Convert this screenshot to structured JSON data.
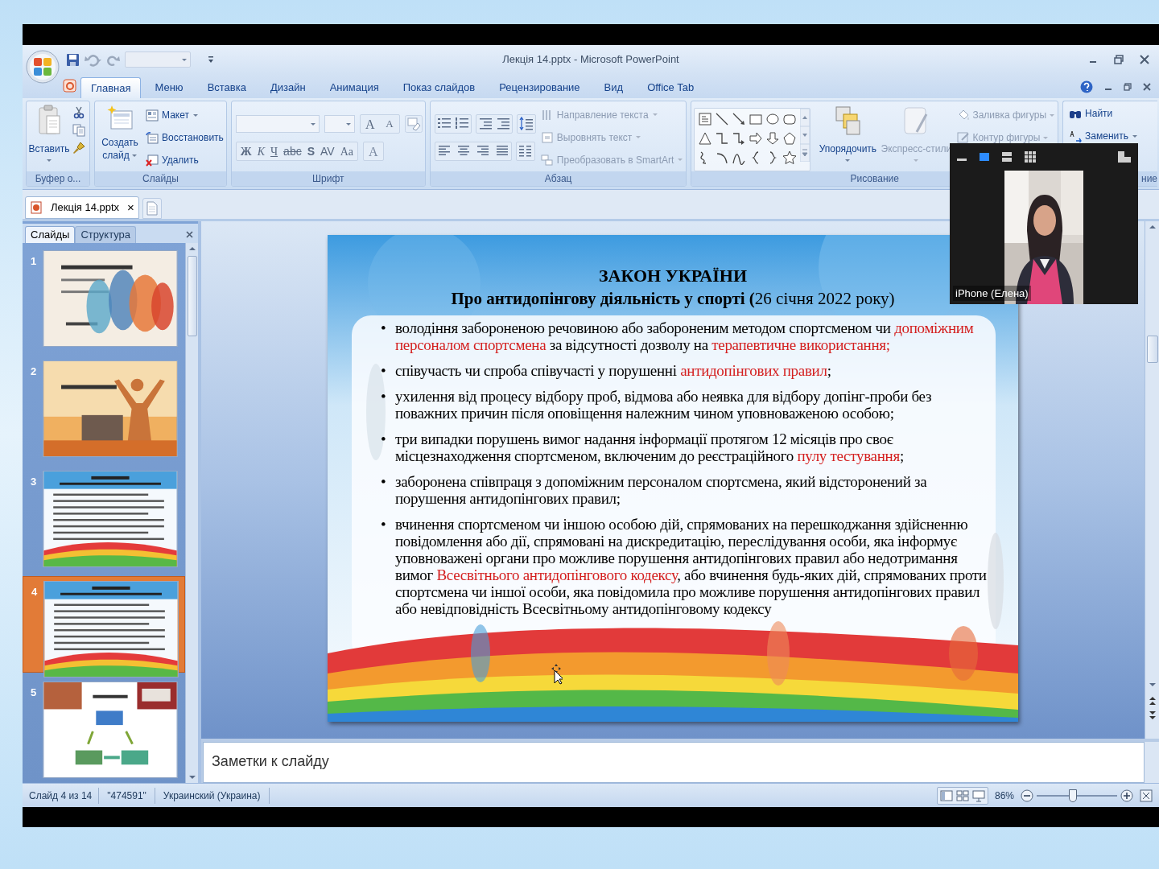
{
  "window": {
    "title": "Лекція 14.pptx - Microsoft PowerPoint"
  },
  "ribbon_tabs": [
    {
      "label": "Главная",
      "selected": true
    },
    {
      "label": "Меню",
      "selected": false
    },
    {
      "label": "Вставка",
      "selected": false
    },
    {
      "label": "Дизайн",
      "selected": false
    },
    {
      "label": "Анимация",
      "selected": false
    },
    {
      "label": "Показ слайдов",
      "selected": false
    },
    {
      "label": "Рецензирование",
      "selected": false
    },
    {
      "label": "Вид",
      "selected": false
    },
    {
      "label": "Office Tab",
      "selected": false
    }
  ],
  "ribbon": {
    "clipboard": {
      "label": "Буфер о...",
      "paste": "Вставить"
    },
    "slides": {
      "label": "Слайды",
      "new_slide": [
        "Создать",
        "слайд"
      ],
      "commands": [
        "Макет",
        "Восстановить",
        "Удалить"
      ]
    },
    "font": {
      "label": "Шрифт",
      "size_buttons": [
        "A",
        "A"
      ],
      "format_buttons": [
        "Ж",
        "К",
        "Ч",
        "abc",
        "S",
        "AV",
        "Aa"
      ],
      "color_button": "A"
    },
    "paragraph": {
      "label": "Абзац",
      "text_commands": [
        {
          "label": "Направление текста",
          "disabled": true
        },
        {
          "label": "Выровнять текст",
          "disabled": true
        },
        {
          "label": "Преобразовать в SmartArt",
          "disabled": true
        }
      ]
    },
    "drawing": {
      "label": "Рисование",
      "arrange": {
        "label": "Упорядочить",
        "disabled": false
      },
      "quick_styles": {
        "label": "Экспресс-стили",
        "disabled": true
      },
      "shape_commands": [
        {
          "label": "Заливка фигуры",
          "disabled": true
        },
        {
          "label": "Контур фигуры",
          "disabled": true
        }
      ]
    },
    "editing": {
      "label": "ние",
      "commands": [
        "Найти",
        "Заменить"
      ]
    }
  },
  "document_tab": {
    "label": "Лекція 14.pptx",
    "close": "×"
  },
  "panel_tabs": [
    {
      "label": "Слайды",
      "selected": true
    },
    {
      "label": "Структура",
      "selected": false
    }
  ],
  "slides": [
    {
      "number": "1",
      "selected": false
    },
    {
      "number": "2",
      "selected": false
    },
    {
      "number": "3",
      "selected": false
    },
    {
      "number": "4",
      "selected": true
    },
    {
      "number": "5",
      "selected": false
    }
  ],
  "slide": {
    "title": "ЗАКОН УКРАЇНИ",
    "subtitle": "**Про антидопінгову діяльність у спорті (**26 січня 2022 року)",
    "bullet": "•",
    "bullets": [
      {
        "segments": [
          {
            "text": "володіння забороненою речовиною або забороненим методом спортсменом чи ",
            "red": false
          },
          {
            "text": "допоміжним персоналом спортсмена",
            "red": true
          },
          {
            "text": " за відсутності дозволу на ",
            "red": false
          },
          {
            "text": "терапевтичне використання;",
            "red": true
          }
        ]
      },
      {
        "segments": [
          {
            "text": "співучасть чи спроба співучасті у порушенні ",
            "red": false
          },
          {
            "text": "антидопінгових правил",
            "red": true
          },
          {
            "text": ";",
            "red": false
          }
        ]
      },
      {
        "segments": [
          {
            "text": "ухилення від процесу відбору проб, відмова або неявка для відбору допінг-проби без поважних причин після оповіщення належним чином уповноваженою особою;",
            "red": false
          }
        ]
      },
      {
        "segments": [
          {
            "text": "три випадки порушень вимог надання інформації протягом 12 місяців про своє місцезнаходження спортсменом, включеним до реєстраційного ",
            "red": false
          },
          {
            "text": "пулу тестування",
            "red": true
          },
          {
            "text": ";",
            "red": false
          }
        ]
      },
      {
        "segments": [
          {
            "text": "заборонена співпраця з допоміжним персоналом спортсмена, який відсторонений за порушення антидопінгових правил;",
            "red": false
          }
        ]
      },
      {
        "segments": [
          {
            "text": "вчинення спортсменом чи іншою особою дій, спрямованих на перешкоджання здійсненню повідомлення або дії, спрямовані на дискредитацію, переслідування особи, яка інформує уповноважені органи про можливе порушення антидопінгових правил або недотримання вимог ",
            "red": false
          },
          {
            "text": "Всесвітнього антидопінгового кодексу",
            "red": true
          },
          {
            "text": ", або вчинення будь-яких дій, спрямованих проти спортсмена чи іншої особи, яка повідомила про можливе порушення антидопінгових правил або невідповідність Всесвітньому антидопінговому кодексу",
            "red": false
          }
        ]
      }
    ]
  },
  "notes": {
    "placeholder": "Заметки к слайду"
  },
  "status_bar": {
    "slide": "Слайд 4 из 14",
    "theme": "\"474591\"",
    "language": "Украинский (Украина)",
    "zoom": "86%",
    "zoom_slider": {
      "level": 0.45
    }
  },
  "video": {
    "name": "iPhone (Елена)"
  }
}
